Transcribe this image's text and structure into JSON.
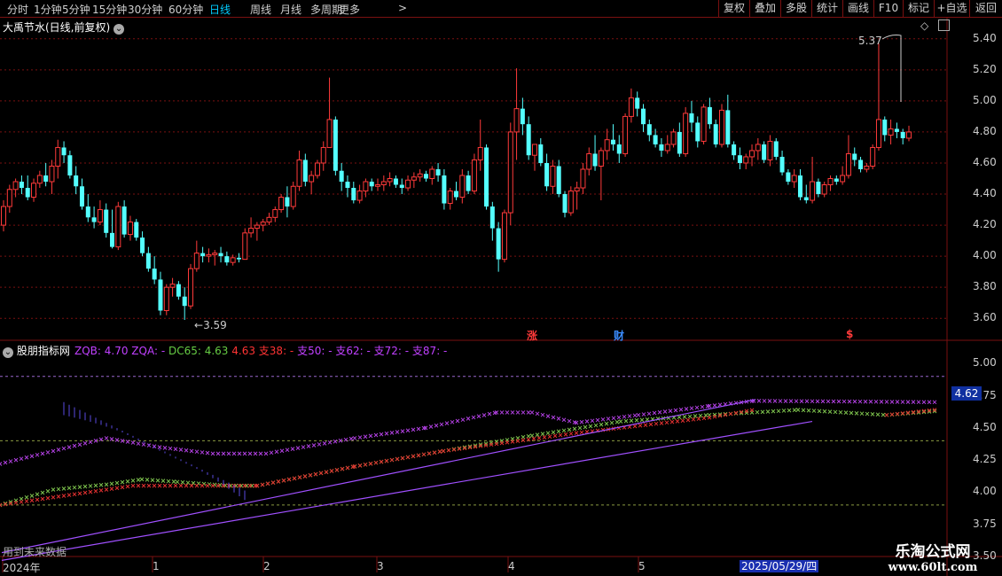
{
  "toolbar": {
    "periods": [
      "分时",
      "1分钟",
      "5分钟",
      "15分钟",
      "30分钟",
      "60分钟",
      "日线",
      "周线",
      "月线",
      "多周期",
      "更多"
    ],
    "active_period": "日线",
    "more_arrow": ">",
    "right_buttons": [
      "复权",
      "叠加",
      "多股",
      "统计",
      "画线",
      "F10",
      "标记",
      "+自选",
      "返回"
    ]
  },
  "main_chart": {
    "title": "大禹节水(日线,前复权)",
    "title_arrow": "⌄",
    "high_label": "5.37",
    "low_label": "3.59",
    "price_axis": [
      "5.40",
      "5.20",
      "5.00",
      "4.80",
      "4.60",
      "4.40",
      "4.20",
      "4.00",
      "3.80",
      "3.60"
    ],
    "markers": [
      {
        "text": "涨",
        "color": "#ff3a3a"
      },
      {
        "text": "财",
        "color": "#3a8cff"
      },
      {
        "text": "$",
        "color": "#ff3a3a"
      }
    ]
  },
  "indicator": {
    "name": "股朋指标网",
    "params": [
      {
        "text": "ZQB: 4.70",
        "color": "#c040ff"
      },
      {
        "text": "ZQA: -",
        "color": "#c040ff"
      },
      {
        "text": "DC65: 4.63",
        "color": "#66cc44"
      },
      {
        "text": "4.63",
        "color": "#ff3333"
      },
      {
        "text": "支38: -",
        "color": "#ff3333"
      },
      {
        "text": "支50: -",
        "color": "#c040ff"
      },
      {
        "text": "支62: -",
        "color": "#c040ff"
      },
      {
        "text": "支72: -",
        "color": "#c040ff"
      },
      {
        "text": "支87: -",
        "color": "#c040ff"
      }
    ],
    "axis": [
      "5.00",
      "4.75",
      "4.50",
      "4.25",
      "4.00",
      "3.75",
      "3.50"
    ],
    "current_value": "4.62",
    "future_note": "用到未来数据"
  },
  "date_axis": {
    "labels": [
      "2024年",
      "1",
      "2",
      "3",
      "4",
      "5"
    ],
    "cursor_date": "2025/05/29/四"
  },
  "watermark": {
    "title": "乐淘公式网",
    "url": "www.60lt.com"
  },
  "colors": {
    "up": "#ff3a3a",
    "down": "#54ffff",
    "grid": "#7a1010",
    "text": "#c8c8c8",
    "purple": "#c040ff",
    "green": "#66cc44"
  },
  "chart_data": {
    "type": "candlestick",
    "ylim": [
      3.55,
      5.45
    ],
    "ohlc": [
      [
        4.2,
        4.36,
        4.16,
        4.32
      ],
      [
        4.32,
        4.46,
        4.28,
        4.43
      ],
      [
        4.43,
        4.5,
        4.38,
        4.48
      ],
      [
        4.48,
        4.52,
        4.4,
        4.44
      ],
      [
        4.44,
        4.52,
        4.36,
        4.38
      ],
      [
        4.38,
        4.5,
        4.35,
        4.47
      ],
      [
        4.47,
        4.55,
        4.44,
        4.52
      ],
      [
        4.52,
        4.6,
        4.45,
        4.48
      ],
      [
        4.48,
        4.62,
        4.4,
        4.58
      ],
      [
        4.58,
        4.75,
        4.5,
        4.7
      ],
      [
        4.7,
        4.74,
        4.6,
        4.65
      ],
      [
        4.65,
        4.68,
        4.5,
        4.52
      ],
      [
        4.52,
        4.58,
        4.4,
        4.45
      ],
      [
        4.45,
        4.5,
        4.3,
        4.32
      ],
      [
        4.32,
        4.4,
        4.22,
        4.25
      ],
      [
        4.25,
        4.32,
        4.18,
        4.22
      ],
      [
        4.22,
        4.36,
        4.2,
        4.3
      ],
      [
        4.3,
        4.34,
        4.12,
        4.15
      ],
      [
        4.15,
        4.3,
        4.05,
        4.06
      ],
      [
        4.06,
        4.35,
        4.04,
        4.32
      ],
      [
        4.32,
        4.36,
        4.12,
        4.14
      ],
      [
        4.14,
        4.26,
        4.1,
        4.22
      ],
      [
        4.22,
        4.24,
        4.1,
        4.12
      ],
      [
        4.12,
        4.16,
        4.0,
        4.02
      ],
      [
        4.02,
        4.06,
        3.9,
        3.92
      ],
      [
        3.92,
        4.0,
        3.82,
        3.85
      ],
      [
        3.85,
        3.9,
        3.62,
        3.65
      ],
      [
        3.65,
        3.82,
        3.62,
        3.8
      ],
      [
        3.8,
        3.86,
        3.74,
        3.82
      ],
      [
        3.82,
        3.84,
        3.72,
        3.74
      ],
      [
        3.74,
        3.8,
        3.59,
        3.68
      ],
      [
        3.68,
        3.95,
        3.66,
        3.92
      ],
      [
        3.92,
        4.1,
        3.9,
        4.02
      ],
      [
        4.02,
        4.06,
        3.96,
        4.0
      ],
      [
        4.0,
        4.05,
        3.96,
        4.01
      ],
      [
        4.01,
        4.04,
        3.94,
        4.02
      ],
      [
        4.02,
        4.06,
        3.96,
        4.0
      ],
      [
        4.0,
        4.03,
        3.94,
        3.96
      ],
      [
        3.96,
        4.01,
        3.94,
        3.99
      ],
      [
        3.99,
        4.02,
        3.96,
        3.98
      ],
      [
        3.98,
        4.18,
        3.98,
        4.15
      ],
      [
        4.15,
        4.25,
        4.12,
        4.18
      ],
      [
        4.18,
        4.22,
        4.1,
        4.2
      ],
      [
        4.2,
        4.24,
        4.16,
        4.22
      ],
      [
        4.22,
        4.28,
        4.2,
        4.25
      ],
      [
        4.25,
        4.32,
        4.22,
        4.3
      ],
      [
        4.3,
        4.4,
        4.28,
        4.38
      ],
      [
        4.38,
        4.45,
        4.25,
        4.32
      ],
      [
        4.32,
        4.48,
        4.3,
        4.45
      ],
      [
        4.45,
        4.68,
        4.42,
        4.62
      ],
      [
        4.62,
        4.66,
        4.45,
        4.48
      ],
      [
        4.48,
        4.55,
        4.4,
        4.52
      ],
      [
        4.52,
        4.62,
        4.5,
        4.6
      ],
      [
        4.6,
        4.74,
        4.55,
        4.7
      ],
      [
        4.7,
        5.15,
        4.7,
        4.88
      ],
      [
        4.88,
        4.9,
        4.52,
        4.55
      ],
      [
        4.55,
        4.6,
        4.42,
        4.48
      ],
      [
        4.48,
        4.52,
        4.38,
        4.44
      ],
      [
        4.44,
        4.48,
        4.34,
        4.36
      ],
      [
        4.36,
        4.46,
        4.34,
        4.42
      ],
      [
        4.42,
        4.5,
        4.38,
        4.48
      ],
      [
        4.48,
        4.5,
        4.42,
        4.45
      ],
      [
        4.45,
        4.5,
        4.42,
        4.46
      ],
      [
        4.46,
        4.52,
        4.42,
        4.48
      ],
      [
        4.48,
        4.54,
        4.45,
        4.5
      ],
      [
        4.5,
        4.52,
        4.44,
        4.46
      ],
      [
        4.46,
        4.5,
        4.4,
        4.44
      ],
      [
        4.44,
        4.52,
        4.42,
        4.49
      ],
      [
        4.49,
        4.54,
        4.44,
        4.51
      ],
      [
        4.51,
        4.56,
        4.48,
        4.53
      ],
      [
        4.53,
        4.55,
        4.48,
        4.5
      ],
      [
        4.5,
        4.58,
        4.46,
        4.56
      ],
      [
        4.56,
        4.6,
        4.48,
        4.52
      ],
      [
        4.52,
        4.56,
        4.3,
        4.34
      ],
      [
        4.34,
        4.44,
        4.3,
        4.42
      ],
      [
        4.42,
        4.48,
        4.36,
        4.38
      ],
      [
        4.38,
        4.56,
        4.34,
        4.52
      ],
      [
        4.52,
        4.55,
        4.4,
        4.42
      ],
      [
        4.42,
        4.66,
        4.4,
        4.62
      ],
      [
        4.62,
        4.88,
        4.55,
        4.7
      ],
      [
        4.7,
        4.72,
        4.3,
        4.32
      ],
      [
        4.32,
        4.35,
        4.1,
        4.18
      ],
      [
        4.18,
        4.22,
        3.9,
        3.98
      ],
      [
        3.98,
        4.3,
        3.96,
        4.28
      ],
      [
        4.28,
        4.86,
        4.2,
        4.8
      ],
      [
        4.8,
        5.21,
        4.62,
        4.95
      ],
      [
        4.95,
        5.02,
        4.78,
        4.85
      ],
      [
        4.85,
        4.9,
        4.62,
        4.65
      ],
      [
        4.65,
        4.68,
        4.55,
        4.72
      ],
      [
        4.72,
        4.76,
        4.58,
        4.6
      ],
      [
        4.6,
        4.66,
        4.42,
        4.45
      ],
      [
        4.45,
        4.62,
        4.4,
        4.58
      ],
      [
        4.58,
        4.62,
        4.38,
        4.4
      ],
      [
        4.4,
        4.42,
        4.25,
        4.28
      ],
      [
        4.28,
        4.45,
        4.26,
        4.42
      ],
      [
        4.42,
        4.48,
        4.3,
        4.44
      ],
      [
        4.44,
        4.6,
        4.4,
        4.56
      ],
      [
        4.56,
        4.7,
        4.52,
        4.66
      ],
      [
        4.66,
        4.78,
        4.55,
        4.58
      ],
      [
        4.58,
        4.7,
        4.36,
        4.68
      ],
      [
        4.68,
        4.82,
        4.62,
        4.75
      ],
      [
        4.75,
        4.85,
        4.68,
        4.72
      ],
      [
        4.72,
        4.78,
        4.6,
        4.66
      ],
      [
        4.66,
        4.92,
        4.64,
        4.9
      ],
      [
        4.9,
        5.08,
        4.86,
        5.02
      ],
      [
        5.02,
        5.06,
        4.9,
        4.95
      ],
      [
        4.95,
        4.98,
        4.8,
        4.85
      ],
      [
        4.85,
        4.88,
        4.74,
        4.78
      ],
      [
        4.78,
        4.82,
        4.7,
        4.72
      ],
      [
        4.72,
        4.76,
        4.64,
        4.68
      ],
      [
        4.68,
        4.78,
        4.66,
        4.72
      ],
      [
        4.72,
        4.82,
        4.7,
        4.8
      ],
      [
        4.8,
        4.86,
        4.64,
        4.66
      ],
      [
        4.66,
        4.96,
        4.64,
        4.92
      ],
      [
        4.92,
        5.0,
        4.8,
        4.86
      ],
      [
        4.86,
        4.9,
        4.7,
        4.74
      ],
      [
        4.74,
        4.98,
        4.72,
        4.96
      ],
      [
        4.96,
        5.02,
        4.82,
        4.85
      ],
      [
        4.85,
        4.88,
        4.7,
        4.72
      ],
      [
        4.72,
        4.98,
        4.7,
        4.94
      ],
      [
        4.94,
        5.04,
        4.7,
        4.72
      ],
      [
        4.72,
        4.74,
        4.62,
        4.65
      ],
      [
        4.65,
        4.7,
        4.56,
        4.6
      ],
      [
        4.6,
        4.66,
        4.56,
        4.64
      ],
      [
        4.64,
        4.72,
        4.58,
        4.68
      ],
      [
        4.68,
        4.76,
        4.62,
        4.72
      ],
      [
        4.72,
        4.74,
        4.6,
        4.62
      ],
      [
        4.62,
        4.78,
        4.58,
        4.74
      ],
      [
        4.74,
        4.76,
        4.62,
        4.64
      ],
      [
        4.64,
        4.68,
        4.52,
        4.54
      ],
      [
        4.54,
        4.56,
        4.46,
        4.48
      ],
      [
        4.48,
        4.56,
        4.44,
        4.52
      ],
      [
        4.52,
        4.56,
        4.36,
        4.38
      ],
      [
        4.38,
        4.46,
        4.34,
        4.36
      ],
      [
        4.36,
        4.64,
        4.34,
        4.48
      ],
      [
        4.48,
        4.5,
        4.38,
        4.4
      ],
      [
        4.4,
        4.48,
        4.38,
        4.46
      ],
      [
        4.46,
        4.52,
        4.42,
        4.5
      ],
      [
        4.5,
        4.52,
        4.46,
        4.48
      ],
      [
        4.48,
        4.58,
        4.46,
        4.52
      ],
      [
        4.52,
        4.78,
        4.5,
        4.66
      ],
      [
        4.66,
        4.7,
        4.58,
        4.62
      ],
      [
        4.62,
        4.64,
        4.54,
        4.56
      ],
      [
        4.56,
        4.6,
        4.54,
        4.58
      ],
      [
        4.58,
        4.72,
        4.56,
        4.7
      ],
      [
        4.7,
        5.37,
        4.68,
        4.88
      ],
      [
        4.88,
        4.9,
        4.74,
        4.78
      ],
      [
        4.78,
        4.88,
        4.72,
        4.82
      ],
      [
        4.82,
        4.86,
        4.76,
        4.8
      ],
      [
        4.8,
        4.82,
        4.72,
        4.76
      ],
      [
        4.76,
        4.84,
        4.74,
        4.8
      ]
    ]
  }
}
